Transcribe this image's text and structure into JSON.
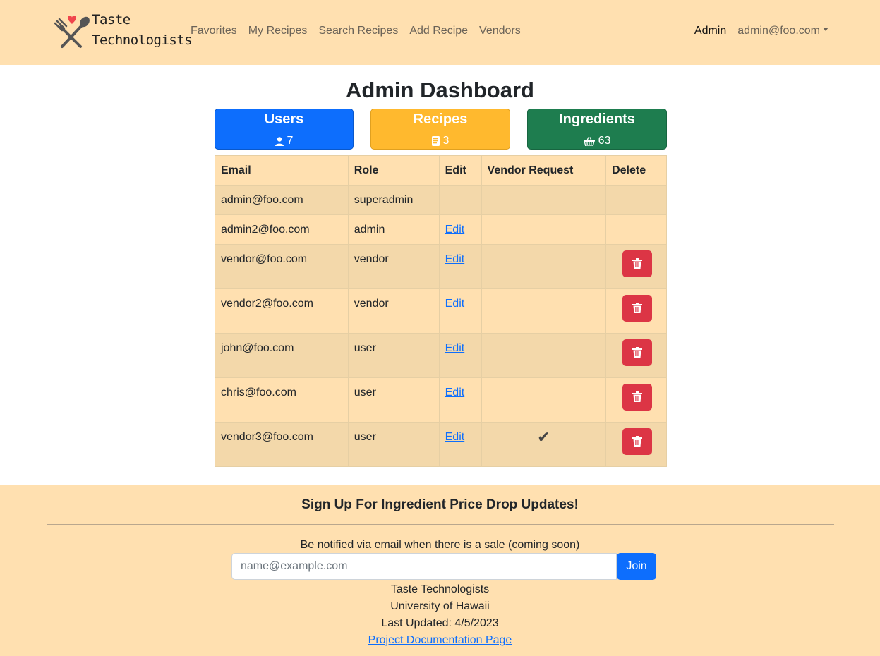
{
  "navbar": {
    "brand_line1": "Taste",
    "brand_line2": "Technologists",
    "links": [
      "Favorites",
      "My Recipes",
      "Search Recipes",
      "Add Recipe",
      "Vendors"
    ],
    "admin_label": "Admin",
    "user_email": "admin@foo.com"
  },
  "page": {
    "title": "Admin Dashboard"
  },
  "stats": {
    "users": {
      "label": "Users",
      "count": "7",
      "icon": "person-icon"
    },
    "recipes": {
      "label": "Recipes",
      "count": "3",
      "icon": "document-icon"
    },
    "ingredients": {
      "label": "Ingredients",
      "count": "63",
      "icon": "basket-icon"
    }
  },
  "table": {
    "headers": [
      "Email",
      "Role",
      "Edit",
      "Vendor Request",
      "Delete"
    ],
    "edit_label": "Edit",
    "check_mark": "✔",
    "rows": [
      {
        "email": "admin@foo.com",
        "role": "superadmin",
        "editable": false,
        "vendor_request": false,
        "deletable": false
      },
      {
        "email": "admin2@foo.com",
        "role": "admin",
        "editable": true,
        "vendor_request": false,
        "deletable": false
      },
      {
        "email": "vendor@foo.com",
        "role": "vendor",
        "editable": true,
        "vendor_request": false,
        "deletable": true
      },
      {
        "email": "vendor2@foo.com",
        "role": "vendor",
        "editable": true,
        "vendor_request": false,
        "deletable": true
      },
      {
        "email": "john@foo.com",
        "role": "user",
        "editable": true,
        "vendor_request": false,
        "deletable": true
      },
      {
        "email": "chris@foo.com",
        "role": "user",
        "editable": true,
        "vendor_request": false,
        "deletable": true
      },
      {
        "email": "vendor3@foo.com",
        "role": "user",
        "editable": true,
        "vendor_request": true,
        "deletable": true
      }
    ]
  },
  "footer": {
    "heading": "Sign Up For Ingredient Price Drop Updates!",
    "note": "Be notified via email when there is a sale (coming soon)",
    "email_placeholder": "name@example.com",
    "join_label": "Join",
    "org": "Taste Technologists",
    "school": "University of Hawaii",
    "updated": "Last Updated: 4/5/2023",
    "doc_link": "Project Documentation Page"
  },
  "colors": {
    "navbar_bg": "#ffe0b0",
    "users_card": "#0d6efd",
    "recipes_card": "#ffb92e",
    "ingredients_card": "#1e7d4f",
    "delete_button": "#dc3545",
    "link": "#0d6efd"
  }
}
